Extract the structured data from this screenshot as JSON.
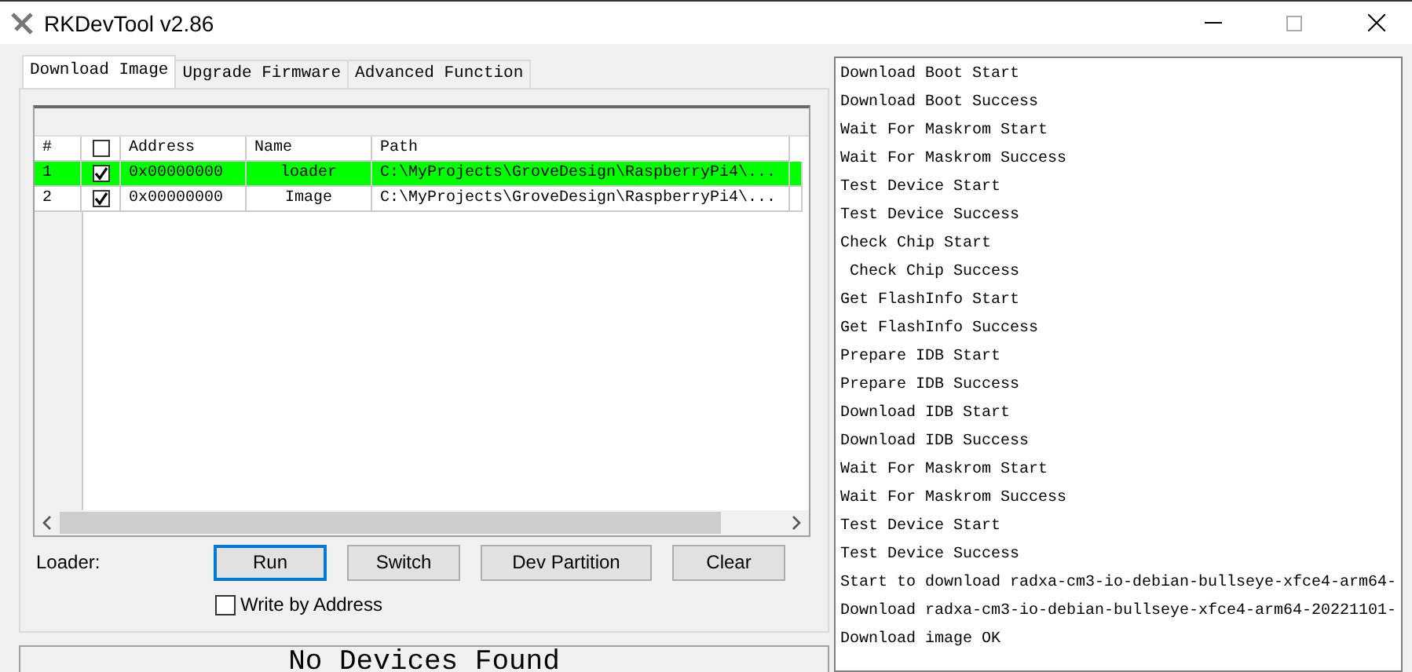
{
  "window": {
    "title": "RKDevTool v2.86"
  },
  "tabs": [
    {
      "label": "Download Image",
      "selected": true
    },
    {
      "label": "Upgrade Firmware",
      "selected": false
    },
    {
      "label": "Advanced Function",
      "selected": false
    }
  ],
  "table": {
    "columns": [
      "#",
      "Address",
      "Name",
      "Path"
    ],
    "header_checked": false,
    "rows": [
      {
        "index": "1",
        "checked": true,
        "address": "0x00000000",
        "name": "loader",
        "path": "C:\\MyProjects\\GroveDesign\\RaspberryPi4\\...",
        "selected": true
      },
      {
        "index": "2",
        "checked": true,
        "address": "0x00000000",
        "name": "Image",
        "path": "C:\\MyProjects\\GroveDesign\\RaspberryPi4\\...",
        "selected": false
      }
    ]
  },
  "loader_label": "Loader:",
  "buttons": [
    {
      "label": "Run",
      "focused": true
    },
    {
      "label": "Switch",
      "focused": false
    },
    {
      "label": "Dev Partition",
      "focused": false
    },
    {
      "label": "Clear",
      "focused": false
    }
  ],
  "write_by_address": {
    "label": "Write by Address",
    "checked": false
  },
  "status": "No Devices Found",
  "log": [
    "Download Boot Start",
    "Download Boot Success",
    "Wait For Maskrom Start",
    "Wait For Maskrom Success",
    "Test Device Start",
    "Test Device Success",
    "Check Chip Start",
    " Check Chip Success",
    "Get FlashInfo Start",
    "Get FlashInfo Success",
    "Prepare IDB Start",
    "Prepare IDB Success",
    "Download IDB Start",
    "Download IDB Success",
    "Wait For Maskrom Start",
    "Wait For Maskrom Success",
    "Test Device Start",
    "Test Device Success",
    "Start to download radxa-cm3-io-debian-bullseye-xfce4-arm64-",
    "Download radxa-cm3-io-debian-bullseye-xfce4-arm64-20221101-",
    "Download image OK"
  ]
}
